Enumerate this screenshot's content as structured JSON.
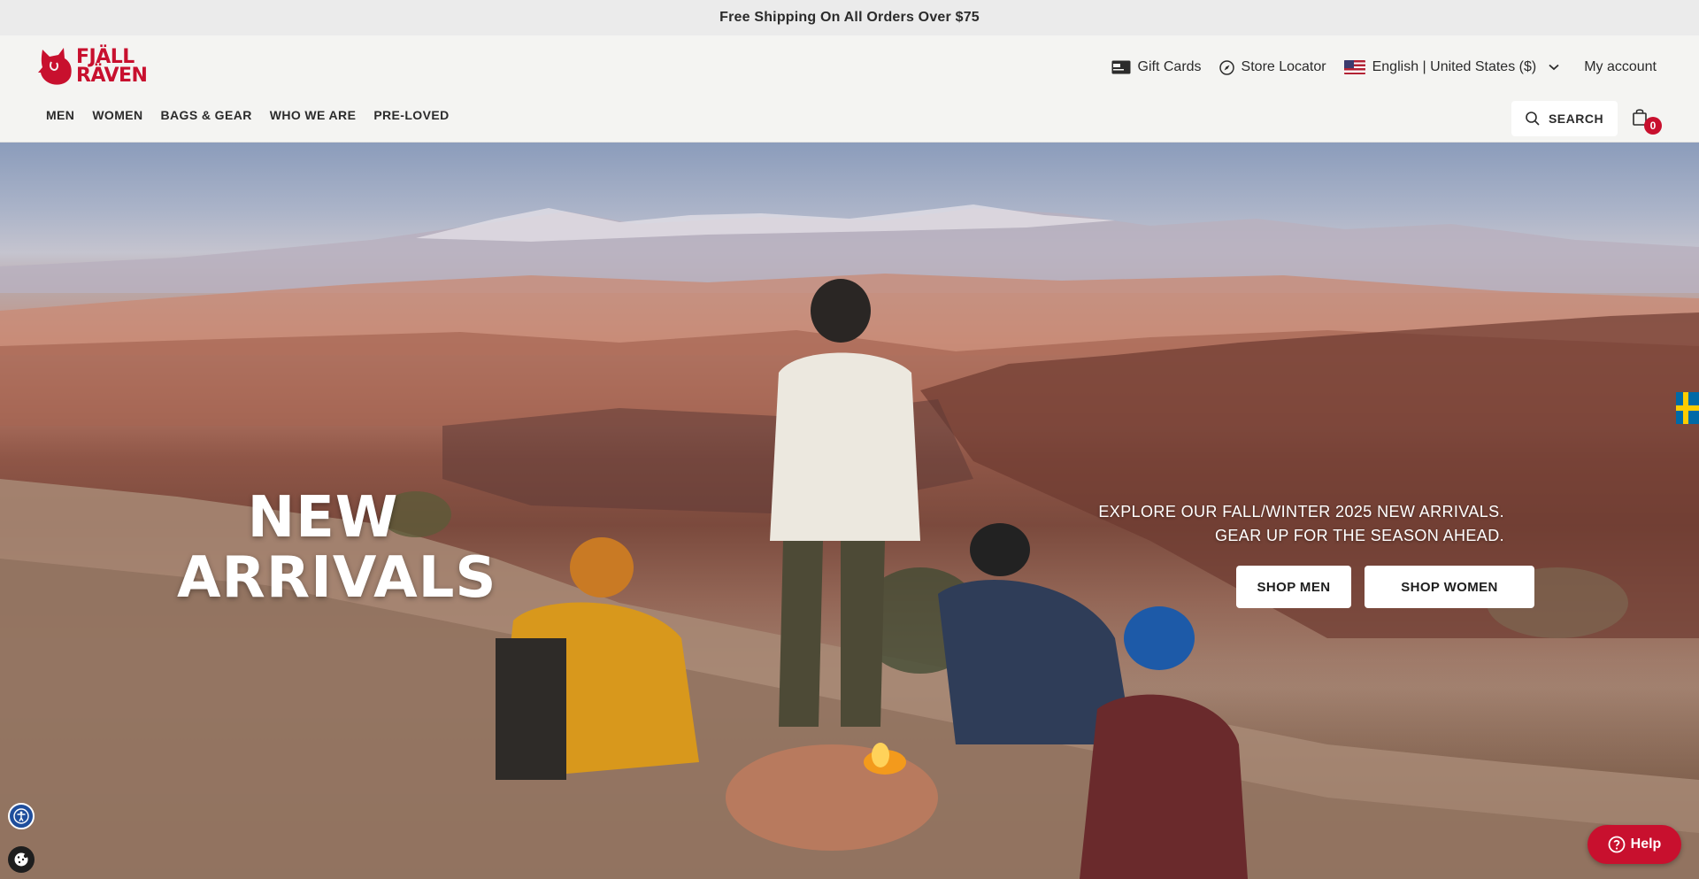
{
  "announcement": {
    "text": "Free Shipping On All Orders Over $75"
  },
  "brand": {
    "line1": "FJÄLL",
    "line2": "RÄVEN",
    "color": "#c8102e"
  },
  "utility_nav": {
    "gift_cards": "Gift Cards",
    "store_locator": "Store Locator",
    "locale": "English | United States ($)",
    "account": "My account"
  },
  "main_nav": {
    "items": [
      {
        "label": "MEN"
      },
      {
        "label": "WOMEN"
      },
      {
        "label": "BAGS & GEAR"
      },
      {
        "label": "WHO WE ARE"
      },
      {
        "label": "PRE-LOVED"
      }
    ]
  },
  "search": {
    "label": "SEARCH",
    "icon": "search-icon"
  },
  "cart": {
    "count": "0",
    "icon": "shopping-bag-icon"
  },
  "hero": {
    "title_line1": "NEW",
    "title_line2": "ARRIVALS",
    "subtitle_line1": "EXPLORE OUR FALL/WINTER 2025 NEW ARRIVALS.",
    "subtitle_line2": "GEAR UP FOR THE SEASON AHEAD.",
    "shop_men": "SHOP MEN",
    "shop_women": "SHOP WOMEN"
  },
  "widgets": {
    "help": "Help",
    "accessibility_icon": "accessibility-icon",
    "cookie_icon": "cookie-icon",
    "region_flag": "sweden-flag-icon"
  },
  "colors": {
    "accent_red": "#c8102e",
    "announce_bg": "#ebebeb",
    "header_bg": "#f4f4f2"
  }
}
